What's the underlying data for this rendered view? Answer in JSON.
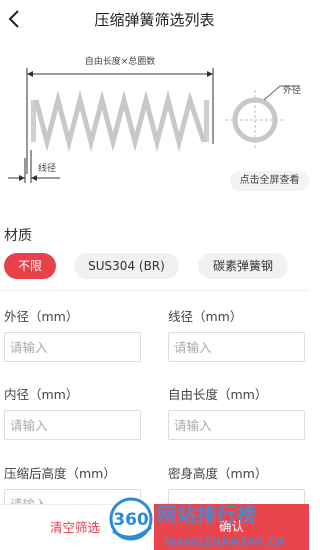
{
  "header": {
    "title": "压缩弹簧筛选列表"
  },
  "diagram": {
    "free_length_label": "自由长度×总圈数",
    "outer_diameter_label": "外径",
    "wire_diameter_label": "线径",
    "fullscreen_label": "点击全屏查看"
  },
  "material": {
    "title": "材质",
    "options": [
      {
        "label": "不限",
        "selected": true
      },
      {
        "label": "SUS304 (BR)",
        "selected": false
      },
      {
        "label": "碳素弹簧钢",
        "selected": false
      }
    ]
  },
  "fields": [
    {
      "label": "外径（mm）",
      "placeholder": "请输入"
    },
    {
      "label": "线径（mm）",
      "placeholder": "请输入"
    },
    {
      "label": "内径（mm）",
      "placeholder": "请输入"
    },
    {
      "label": "自由长度（mm）",
      "placeholder": "请输入"
    },
    {
      "label": "压缩后高度（mm）",
      "placeholder": "请输入"
    },
    {
      "label": "密身高度（mm）",
      "placeholder": ""
    }
  ],
  "footer": {
    "clear_label": "清空筛选",
    "confirm_label": "确认"
  },
  "watermark": {
    "badge": "360",
    "title": "网站排行榜",
    "url": "WANGZHAN360.CN"
  },
  "colors": {
    "accent": "#e9414a",
    "chip_bg": "#f1f1f1",
    "spring": "#c8c8c8"
  }
}
